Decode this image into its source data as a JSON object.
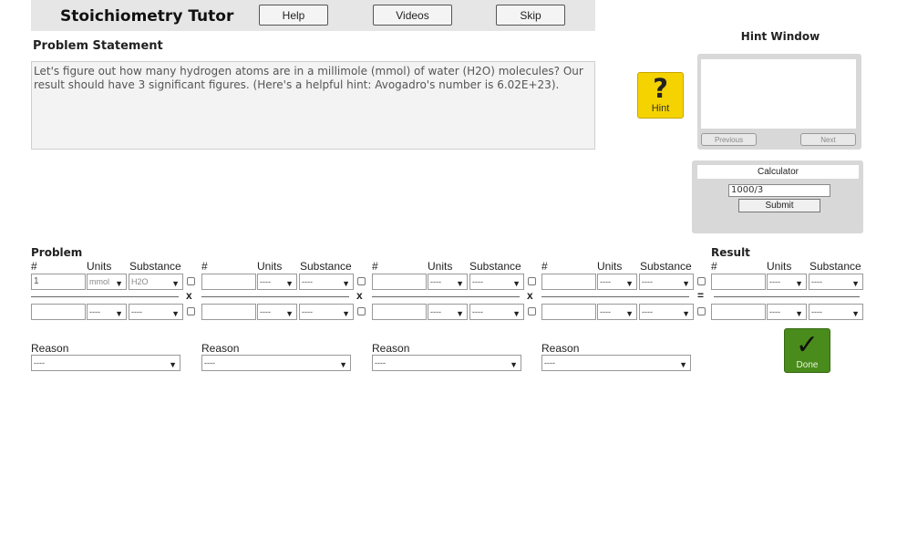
{
  "header": {
    "title": "Stoichiometry Tutor",
    "help_label": "Help",
    "videos_label": "Videos",
    "skip_label": "Skip"
  },
  "problem_statement": {
    "label": "Problem Statement",
    "text": "Let's figure out how many hydrogen atoms are in a millimole (mmol) of water (H2O) molecules? Our result should have 3 significant figures. (Here's a helpful hint: Avogadro's number is 6.02E+23)."
  },
  "hint": {
    "button_symbol": "?",
    "button_label": "Hint",
    "window_title": "Hint Window",
    "previous_label": "Previous",
    "next_label": "Next"
  },
  "calculator": {
    "title": "Calculator",
    "input_value": "1000/3",
    "submit_label": "Submit"
  },
  "grid": {
    "problem_label": "Problem",
    "result_label": "Result",
    "col_num": "#",
    "col_units": "Units",
    "col_substance": "Substance",
    "op_multiply": "x",
    "op_equals": "=",
    "term1": {
      "num_top": "1",
      "units_top": "mmol",
      "substance_top": "H2O",
      "num_bottom": "",
      "units_bottom": "----",
      "substance_bottom": "----"
    },
    "empty_select": "----",
    "reason_label": "Reason",
    "reason_value": "----"
  },
  "done": {
    "symbol": "✓",
    "label": "Done"
  }
}
